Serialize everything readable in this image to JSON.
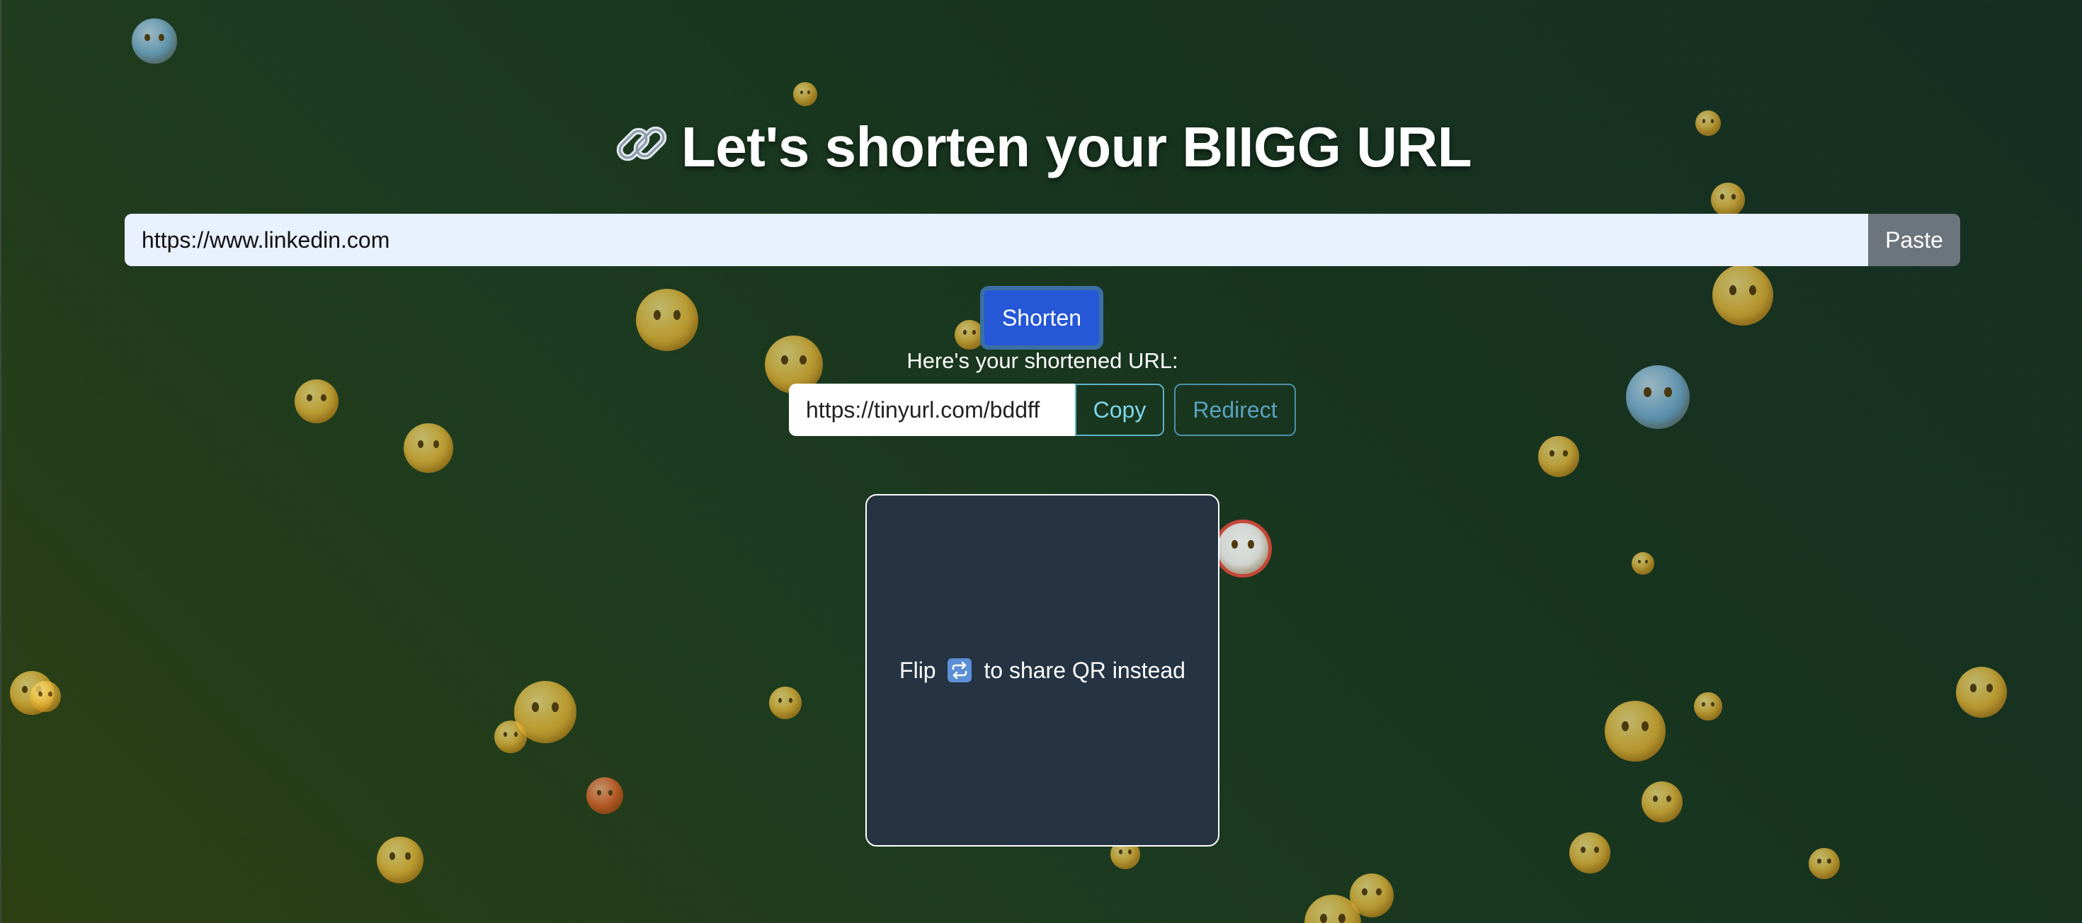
{
  "header": {
    "title": "Let's shorten your BIIGG URL",
    "title_icon": "link-icon"
  },
  "url_form": {
    "input_value": "https://www.linkedin.com",
    "paste_label": "Paste",
    "shorten_label": "Shorten"
  },
  "result": {
    "label": "Here's your shortened URL:",
    "short_url": "https://tinyurl.com/bddff",
    "copy_label": "Copy",
    "redirect_label": "Redirect"
  },
  "flip_card": {
    "text_before": "Flip",
    "icon": "repeat-icon",
    "text_after": "to share QR instead"
  },
  "colors": {
    "shorten_button": "#2557d6",
    "paste_button": "#6c757d",
    "card_background": "#253342",
    "copy_accent": "#7fd6ea"
  }
}
